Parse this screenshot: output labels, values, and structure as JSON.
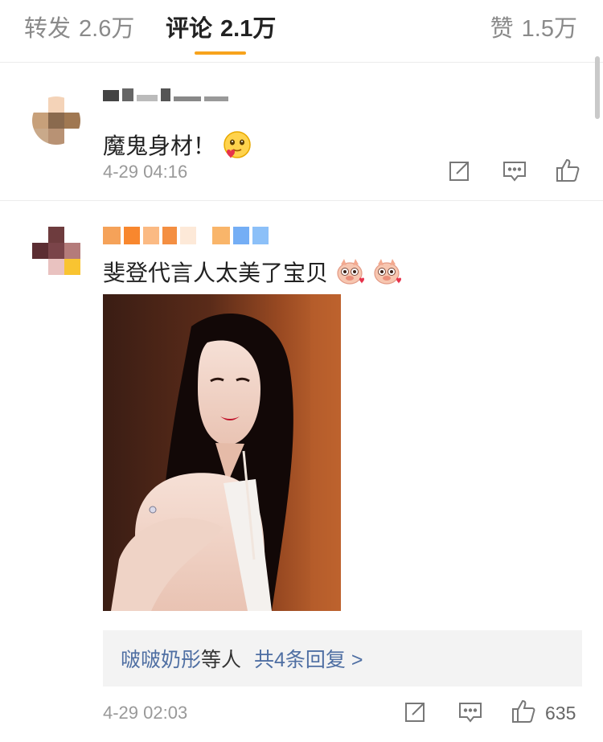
{
  "tabs": {
    "repost": {
      "name": "转发",
      "count": "2.6万"
    },
    "comments": {
      "name": "评论",
      "count": "2.1万"
    },
    "likes": {
      "name": "赞",
      "count": "1.5万"
    }
  },
  "comments": [
    {
      "text": "魔鬼身材！",
      "emoji": "grinning-blush-emoji",
      "time": "4-29 04:16"
    },
    {
      "text": "斐登代言人太美了宝贝",
      "emoji": "pig-heart-eyes-emoji",
      "photo": "woman-portrait-photo",
      "replies": {
        "names": "啵啵奶彤",
        "suffix": "等人",
        "total": "共4条回复 >"
      },
      "time": "4-29 02:03",
      "like_count": "635"
    }
  ],
  "icons": {
    "share": "share-icon",
    "reply": "comment-icon",
    "like": "thumbs-up-icon"
  },
  "colors": {
    "accent": "#f7a31c",
    "link": "#4f6fa3",
    "muted": "#999999"
  }
}
